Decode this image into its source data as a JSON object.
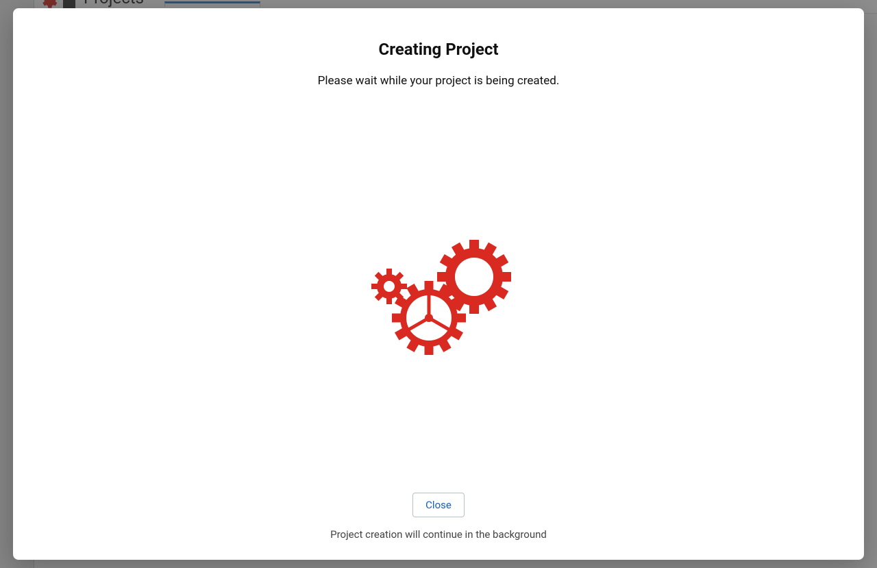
{
  "background": {
    "sidebar_item": "Projects"
  },
  "modal": {
    "title": "Creating Project",
    "subtitle": "Please wait while your project is being created.",
    "spinner_icon": "gears-icon",
    "close_label": "Close",
    "footer_note": "Project creation will continue in the background"
  },
  "colors": {
    "accent_red": "#d82a20",
    "button_text": "#1a5fb4",
    "button_border": "#b8c0c8"
  }
}
